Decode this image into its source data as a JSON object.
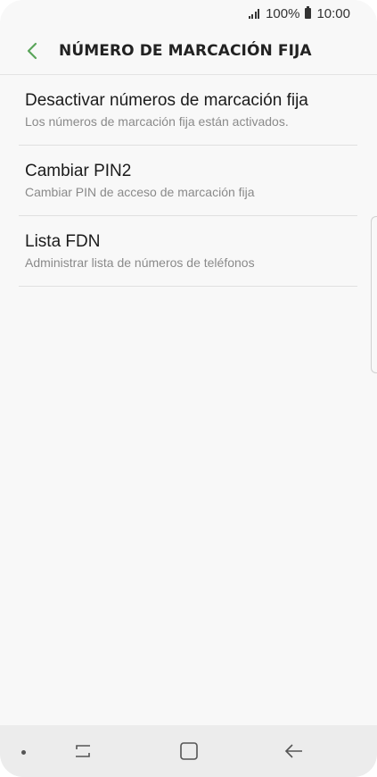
{
  "status_bar": {
    "battery": "100%",
    "time": "10:00",
    "icons": [
      "signal-icon",
      "battery-icon"
    ]
  },
  "app_bar": {
    "title": "NÚMERO DE MARCACIÓN FIJA",
    "back_icon": "chevron-left-icon",
    "accent_color": "#5aa55a"
  },
  "settings": [
    {
      "title": "Desactivar números de marcación fija",
      "subtitle": "Los números de marcación fija están activados."
    },
    {
      "title": "Cambiar PIN2",
      "subtitle": "Cambiar PIN de acceso de marcación fija"
    },
    {
      "title": "Lista FDN",
      "subtitle": "Administrar lista de números de teléfonos"
    }
  ],
  "nav_bar": {
    "buttons": [
      "recent-apps-icon",
      "home-icon",
      "back-arrow-icon"
    ]
  }
}
